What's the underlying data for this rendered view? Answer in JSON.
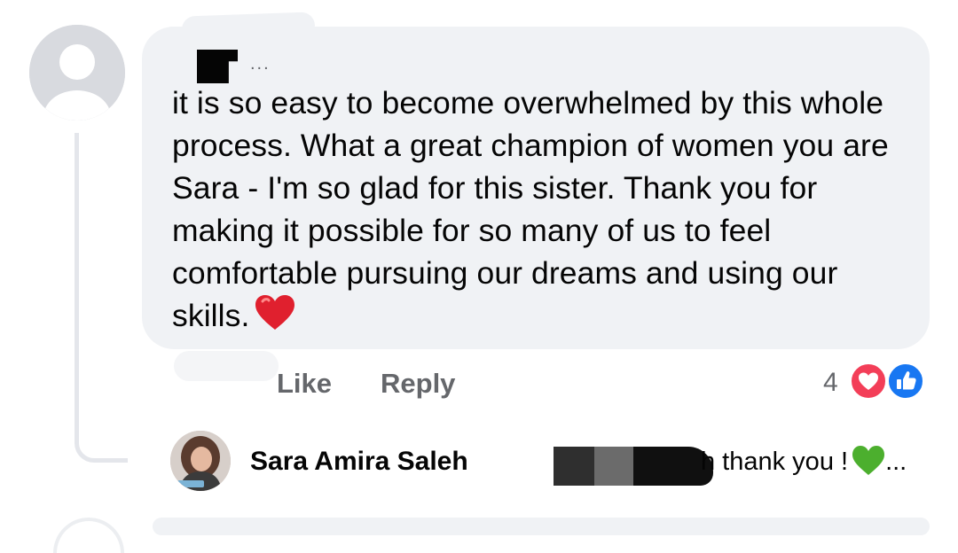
{
  "comment": {
    "text": "it is so easy to become overwhelmed by this whole process. What a great champion of women you are Sara - I'm so glad for this sister. Thank you for making it possible for so many of us to feel comfortable pursuing our dreams and using our skills.",
    "author_suffix": "...",
    "emoji": "red-heart-icon"
  },
  "actions": {
    "like_label": "Like",
    "reply_label": "Reply"
  },
  "reactions": {
    "count": "4",
    "types": [
      "heart-reaction-icon",
      "like-reaction-icon"
    ],
    "heart_color": "#f33e58",
    "like_color": "#1877f2"
  },
  "reply": {
    "author": "Sara Amira Saleh",
    "text": "h thank you !",
    "emoji": "green-heart-icon",
    "ellipsis": "..."
  },
  "colors": {
    "bubble": "#f0f2f5",
    "secondary_text": "#65676b",
    "primary_text": "#050505"
  }
}
